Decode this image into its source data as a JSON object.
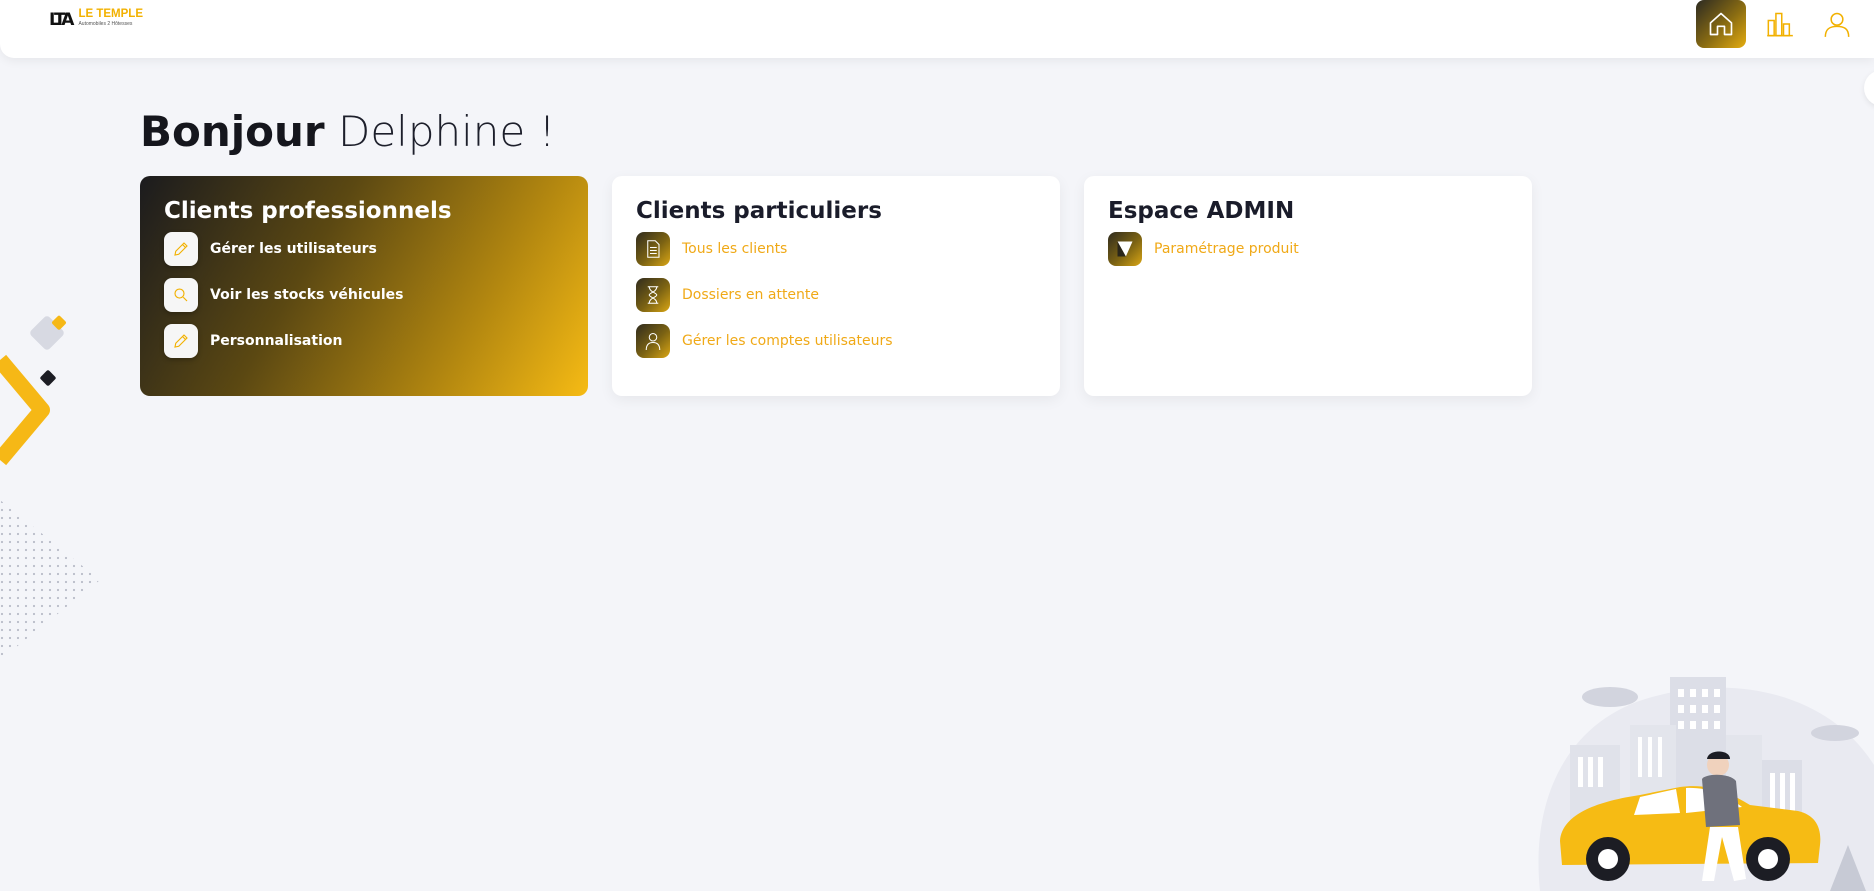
{
  "brand": {
    "mark": "LTA",
    "name": "LE TEMPLE",
    "tagline": "Automobiles 2 Hôtesses"
  },
  "nav": {
    "items": [
      {
        "icon": "home-icon",
        "active": true
      },
      {
        "icon": "bar-chart-icon",
        "active": false
      },
      {
        "icon": "user-icon",
        "active": false
      }
    ]
  },
  "greeting": {
    "hello": "Bonjour",
    "name": "Delphine !"
  },
  "cards": {
    "pro": {
      "title": "Clients professionnels",
      "items": [
        {
          "label": "Gérer les utilisateurs",
          "icon": "pencil-icon"
        },
        {
          "label": "Voir les stocks véhicules",
          "icon": "search-icon"
        },
        {
          "label": "Personnalisation",
          "icon": "pencil-icon"
        }
      ]
    },
    "part": {
      "title": "Clients particuliers",
      "items": [
        {
          "label": "Tous les clients",
          "icon": "document-icon"
        },
        {
          "label": "Dossiers en attente",
          "icon": "hourglass-icon"
        },
        {
          "label": "Gérer les comptes utilisateurs",
          "icon": "user-icon"
        }
      ]
    },
    "admin": {
      "title": "Espace ADMIN",
      "items": [
        {
          "label": "Paramétrage produit",
          "icon": "settings-shape-icon"
        }
      ]
    }
  },
  "colors": {
    "accent": "#f2b100",
    "accent_text": "#f0a917",
    "dark": "#1b1b1e",
    "background": "#f4f5f9"
  }
}
